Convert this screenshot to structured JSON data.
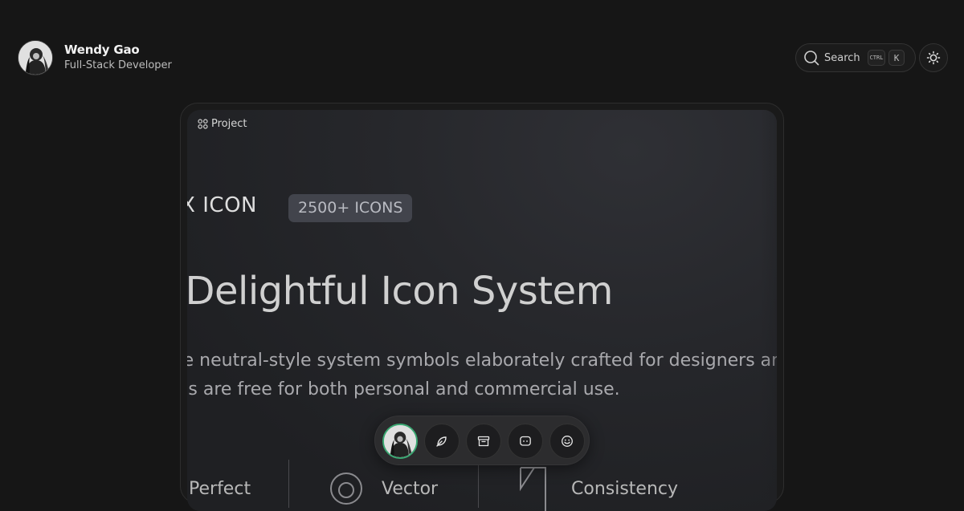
{
  "profile": {
    "name": "Wendy Gao",
    "role": "Full-Stack Developer",
    "avatar_icon": "avatar-photo"
  },
  "header": {
    "search": {
      "label": "Search",
      "shortcut_modifier": "CTRL",
      "shortcut_key": "K",
      "icon": "search-icon"
    },
    "theme_toggle": {
      "icon": "sun-icon"
    }
  },
  "card": {
    "badge": {
      "icon": "grid-icon",
      "label": "Project"
    },
    "preview": {
      "title": "IX ICON",
      "count_badge": "2500+ ICONS",
      "headline": "ly Delightful Icon System",
      "description_line1": "te neutral-style system symbols elaborately crafted for designers and",
      "description_line2": "ons are free for both personal and commercial use.",
      "features": [
        "Perfect",
        "Vector",
        "Consistency"
      ]
    }
  },
  "dock": {
    "items": [
      {
        "name": "dock-avatar",
        "icon": "avatar-photo"
      },
      {
        "name": "dock-writing",
        "icon": "feather-icon"
      },
      {
        "name": "dock-projects",
        "icon": "archive-icon"
      },
      {
        "name": "dock-chat",
        "icon": "chat-icon"
      },
      {
        "name": "dock-about",
        "icon": "smile-icon"
      }
    ]
  },
  "colors": {
    "background": "#161616",
    "card_border": "#2e2e2e",
    "dock_active_ring": "#3aa872",
    "count_badge_bg": "#42444c"
  }
}
